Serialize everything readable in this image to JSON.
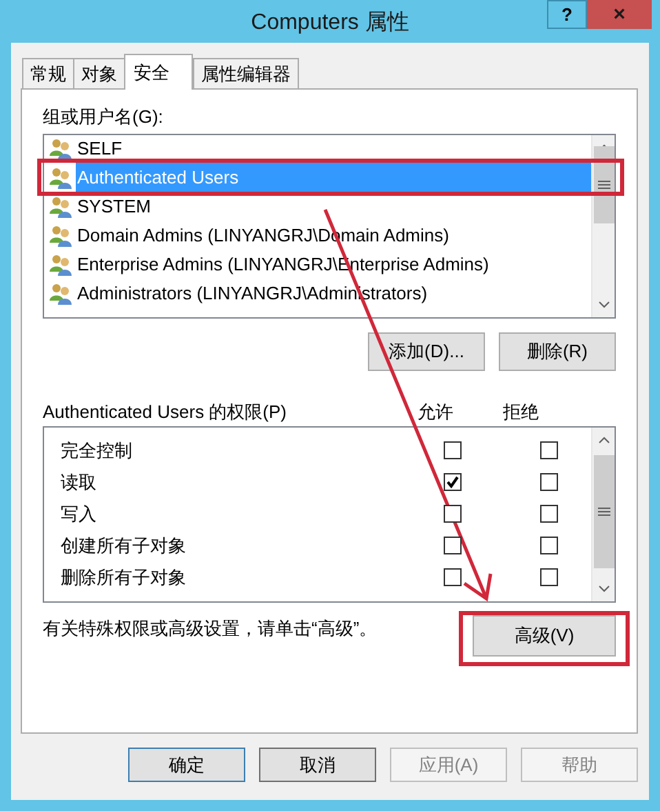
{
  "window": {
    "title": "Computers 属性",
    "help_button": "?",
    "close_button": "×"
  },
  "tabs": [
    {
      "label": "常规",
      "selected": false
    },
    {
      "label": "对象",
      "selected": false
    },
    {
      "label": "安全",
      "selected": true
    },
    {
      "label": "属性编辑器",
      "selected": false
    }
  ],
  "group_label": "组或用户名(G):",
  "groups": [
    {
      "name": "SELF",
      "selected": false
    },
    {
      "name": "Authenticated Users",
      "selected": true
    },
    {
      "name": "SYSTEM",
      "selected": false
    },
    {
      "name": "Domain Admins (LINYANGRJ\\Domain Admins)",
      "selected": false
    },
    {
      "name": "Enterprise Admins (LINYANGRJ\\Enterprise Admins)",
      "selected": false
    },
    {
      "name": "Administrators (LINYANGRJ\\Administrators)",
      "selected": false
    }
  ],
  "group_buttons": [
    "添加(D)...",
    "删除(R)"
  ],
  "permissions_label": "Authenticated Users 的权限(P)",
  "permission_columns": [
    "允许",
    "拒绝"
  ],
  "permissions": [
    {
      "name": "完全控制",
      "allow": false,
      "deny": false
    },
    {
      "name": "读取",
      "allow": true,
      "deny": false
    },
    {
      "name": "写入",
      "allow": false,
      "deny": false
    },
    {
      "name": "创建所有子对象",
      "allow": false,
      "deny": false
    },
    {
      "name": "删除所有子对象",
      "allow": false,
      "deny": false
    }
  ],
  "advanced_note": "有关特殊权限或高级设置，请单击“高级”。",
  "advanced_button": "高级(V)",
  "buttons": [
    {
      "label": "确定",
      "disabled": false,
      "default": true
    },
    {
      "label": "取消",
      "disabled": false,
      "default": false
    },
    {
      "label": "应用(A)",
      "disabled": true,
      "default": false
    },
    {
      "label": "帮助",
      "disabled": true,
      "default": false
    }
  ]
}
